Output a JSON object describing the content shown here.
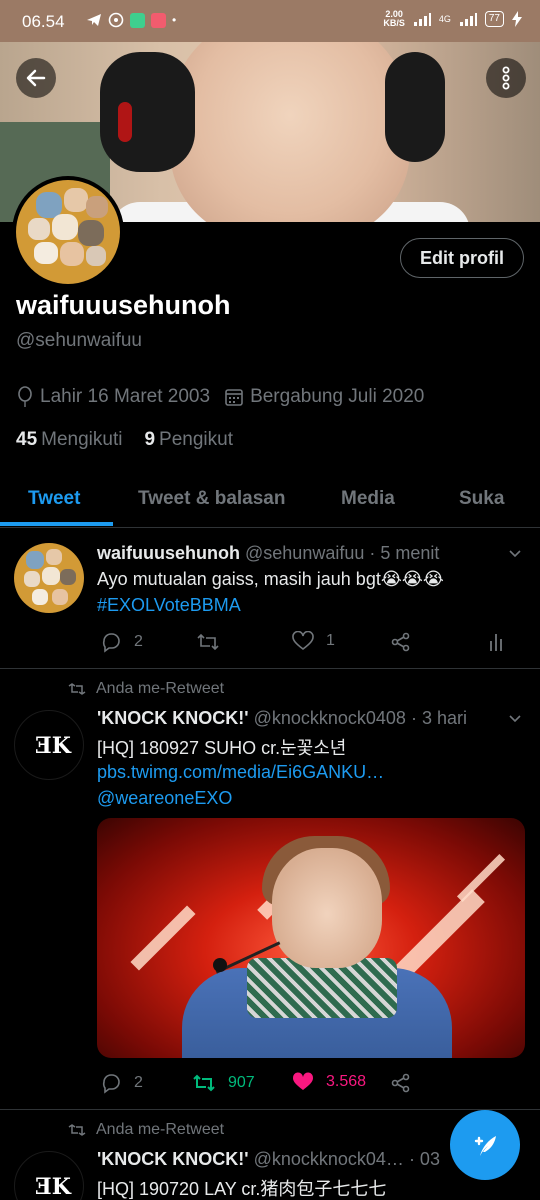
{
  "status_bar": {
    "time": "06.54",
    "net_speed": "2.00",
    "net_unit": "KB/S",
    "network": "4G",
    "battery": "77"
  },
  "profile": {
    "display_name": "waifuuusehunoh",
    "handle": "@sehunwaifuu",
    "edit_label": "Edit profil",
    "birth": "Lahir 16 Maret 2003",
    "joined": "Bergabung Juli 2020",
    "following_count": "45",
    "following_label": "Mengikuti",
    "followers_count": "9",
    "followers_label": "Pengikut"
  },
  "tabs": [
    {
      "label": "Tweet",
      "active": true
    },
    {
      "label": "Tweet & balasan",
      "active": false
    },
    {
      "label": "Media",
      "active": false
    },
    {
      "label": "Suka",
      "active": false
    }
  ],
  "tweets": [
    {
      "name": "waifuuusehunoh",
      "handle": "@sehunwaifuu",
      "time": "· 5 menit",
      "text": "Ayo mutualan gaiss, masih jauh bgt😭😭😭",
      "hashtag": "#EXOLVoteBBMA",
      "replies": "2",
      "likes": "1"
    },
    {
      "retweet_label": "Anda me-Retweet",
      "name": "'KNOCK KNOCK!'",
      "handle": "@knockknock0408",
      "time": "· 3 hari",
      "text": "[HQ] 180927 SUHO cr.눈꽃소년",
      "link": "pbs.twimg.com/media/Ei6GANKU…",
      "mention": "@weareoneEXO",
      "replies": "2",
      "retweets": "907",
      "likes": "3.568"
    },
    {
      "retweet_label": "Anda me-Retweet",
      "name": "'KNOCK KNOCK!'",
      "handle": "@knockknock04…",
      "time": "· 03",
      "text": "[HQ] 190720 LAY cr.猪肉包子七七七"
    }
  ],
  "colors": {
    "accent": "#1d9bf0",
    "retweet_green": "#00ba7c",
    "like_pink": "#f91880",
    "status_bar_bg": "#9b7a65"
  }
}
